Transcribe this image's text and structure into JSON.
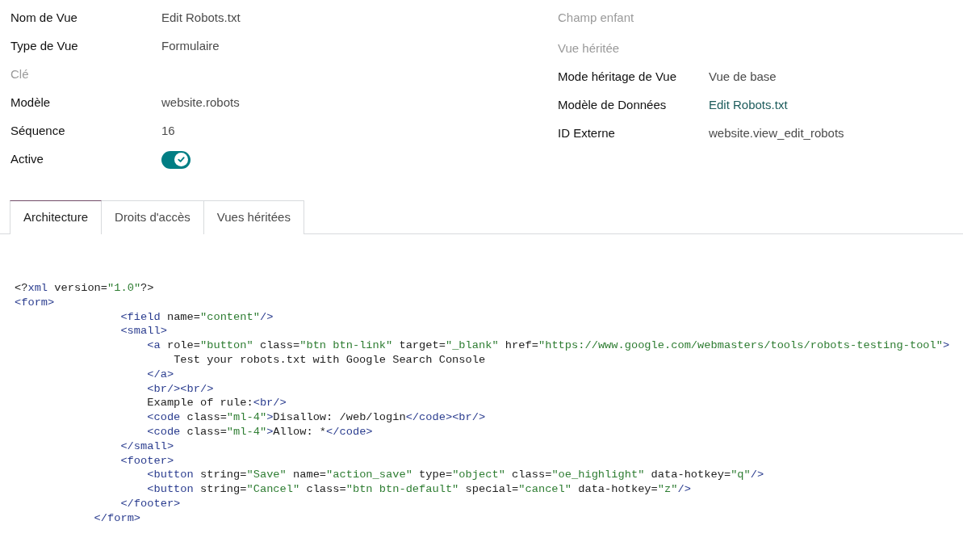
{
  "fields_left": [
    {
      "label": "Nom de Vue",
      "muted": false,
      "kind": "text",
      "value": "Edit Robots.txt"
    },
    {
      "label": "Type de Vue",
      "muted": false,
      "kind": "text",
      "value": "Formulaire"
    },
    {
      "label": "Clé",
      "muted": true,
      "kind": "empty"
    },
    {
      "label": "Modèle",
      "muted": false,
      "kind": "text",
      "value": "website.robots"
    },
    {
      "label": "Séquence",
      "muted": false,
      "kind": "text",
      "value": "16"
    },
    {
      "label": "Active",
      "muted": false,
      "kind": "toggle",
      "on": true
    }
  ],
  "fields_right": [
    {
      "label": "Champ enfant",
      "muted": true,
      "kind": "empty"
    },
    {
      "label": "Vue héritée",
      "muted": true,
      "kind": "empty"
    },
    {
      "label": "Mode héritage de Vue",
      "muted": false,
      "kind": "text",
      "value": "Vue de base"
    },
    {
      "label": "Modèle de Données",
      "muted": false,
      "kind": "link",
      "value": "Edit Robots.txt"
    },
    {
      "label": "ID Externe",
      "muted": false,
      "kind": "text",
      "value": "website.view_edit_robots"
    }
  ],
  "tabs": [
    {
      "label": "Architecture",
      "selected": true
    },
    {
      "label": "Droits d'accès",
      "selected": false
    },
    {
      "label": "Vues héritées",
      "selected": false
    }
  ],
  "code_lines": [
    {
      "kind": "line",
      "tokens": [
        {
          "kind": "plain",
          "text": "<?"
        },
        {
          "kind": "tag",
          "text": "xml"
        },
        {
          "kind": "plain",
          "text": " version="
        },
        {
          "kind": "value",
          "text": "\"1.0\""
        },
        {
          "kind": "plain",
          "text": "?>"
        }
      ]
    },
    {
      "kind": "line",
      "tokens": [
        {
          "kind": "tag",
          "text": "<form>"
        }
      ],
      "children": [
        {
          "kind": "line",
          "tokens": [
            {
              "kind": "tag",
              "text": "<field"
            },
            {
              "kind": "plain",
              "text": " name="
            },
            {
              "kind": "value",
              "text": "\"content\""
            },
            {
              "kind": "tag",
              "text": "/>"
            }
          ]
        },
        {
          "kind": "line",
          "tokens": [
            {
              "kind": "tag",
              "text": "<small>"
            }
          ],
          "children": [
            {
              "kind": "line",
              "tokens": [
                {
                  "kind": "tag",
                  "text": "<a"
                },
                {
                  "kind": "plain",
                  "text": " role="
                },
                {
                  "kind": "value",
                  "text": "\"button\""
                },
                {
                  "kind": "plain",
                  "text": " class="
                },
                {
                  "kind": "value",
                  "text": "\"btn btn-link\""
                },
                {
                  "kind": "plain",
                  "text": " target="
                },
                {
                  "kind": "value",
                  "text": "\"_blank\""
                },
                {
                  "kind": "plain",
                  "text": " href="
                },
                {
                  "kind": "value",
                  "text": "\"https://www.google.com/webmasters/tools/robots-testing-tool\""
                },
                {
                  "kind": "tag",
                  "text": ">"
                }
              ],
              "children": [
                {
                  "kind": "line",
                  "tokens": [
                    {
                      "kind": "plain",
                      "text": "Test your robots.txt with Google Search Console"
                    }
                  ]
                }
              ]
            },
            {
              "kind": "line",
              "tokens": [
                {
                  "kind": "tag",
                  "text": "</a>"
                }
              ]
            },
            {
              "kind": "line",
              "tokens": [
                {
                  "kind": "tag",
                  "text": "<br/><br/>"
                }
              ]
            },
            {
              "kind": "line",
              "tokens": [
                {
                  "kind": "plain",
                  "text": "Example of rule:"
                },
                {
                  "kind": "tag",
                  "text": "<br/>"
                }
              ]
            },
            {
              "kind": "line",
              "tokens": [
                {
                  "kind": "tag",
                  "text": "<code"
                },
                {
                  "kind": "plain",
                  "text": " class="
                },
                {
                  "kind": "value",
                  "text": "\"ml-4\""
                },
                {
                  "kind": "tag",
                  "text": ">"
                },
                {
                  "kind": "plain",
                  "text": "Disallow: /web/login"
                },
                {
                  "kind": "tag",
                  "text": "</code><br/>"
                }
              ]
            },
            {
              "kind": "line",
              "tokens": [
                {
                  "kind": "tag",
                  "text": "<code"
                },
                {
                  "kind": "plain",
                  "text": " class="
                },
                {
                  "kind": "value",
                  "text": "\"ml-4\""
                },
                {
                  "kind": "tag",
                  "text": ">"
                },
                {
                  "kind": "plain",
                  "text": "Allow: *"
                },
                {
                  "kind": "tag",
                  "text": "</code>"
                }
              ]
            }
          ]
        },
        {
          "kind": "line",
          "tokens": [
            {
              "kind": "tag",
              "text": "</small>"
            }
          ]
        },
        {
          "kind": "line",
          "tokens": [
            {
              "kind": "tag",
              "text": "<footer>"
            }
          ],
          "children": [
            {
              "kind": "line",
              "tokens": [
                {
                  "kind": "tag",
                  "text": "<button"
                },
                {
                  "kind": "plain",
                  "text": " string="
                },
                {
                  "kind": "value",
                  "text": "\"Save\""
                },
                {
                  "kind": "plain",
                  "text": " name="
                },
                {
                  "kind": "value",
                  "text": "\"action_save\""
                },
                {
                  "kind": "plain",
                  "text": " type="
                },
                {
                  "kind": "value",
                  "text": "\"object\""
                },
                {
                  "kind": "plain",
                  "text": " class="
                },
                {
                  "kind": "value",
                  "text": "\"oe_highlight\""
                },
                {
                  "kind": "plain",
                  "text": " data-hotkey="
                },
                {
                  "kind": "value",
                  "text": "\"q\""
                },
                {
                  "kind": "tag",
                  "text": "/>"
                }
              ]
            },
            {
              "kind": "line",
              "tokens": [
                {
                  "kind": "tag",
                  "text": "<button"
                },
                {
                  "kind": "plain",
                  "text": " string="
                },
                {
                  "kind": "value",
                  "text": "\"Cancel\""
                },
                {
                  "kind": "plain",
                  "text": " class="
                },
                {
                  "kind": "value",
                  "text": "\"btn btn-default\""
                },
                {
                  "kind": "plain",
                  "text": " special="
                },
                {
                  "kind": "value",
                  "text": "\"cancel\""
                },
                {
                  "kind": "plain",
                  "text": " data-hotkey="
                },
                {
                  "kind": "value",
                  "text": "\"z\""
                },
                {
                  "kind": "tag",
                  "text": "/>"
                }
              ]
            }
          ]
        },
        {
          "kind": "line",
          "tokens": [
            {
              "kind": "tag",
              "text": "</footer>"
            }
          ]
        }
      ]
    },
    {
      "kind": "closing",
      "tokens": [
        {
          "kind": "tag",
          "text": "</form>"
        }
      ]
    }
  ]
}
